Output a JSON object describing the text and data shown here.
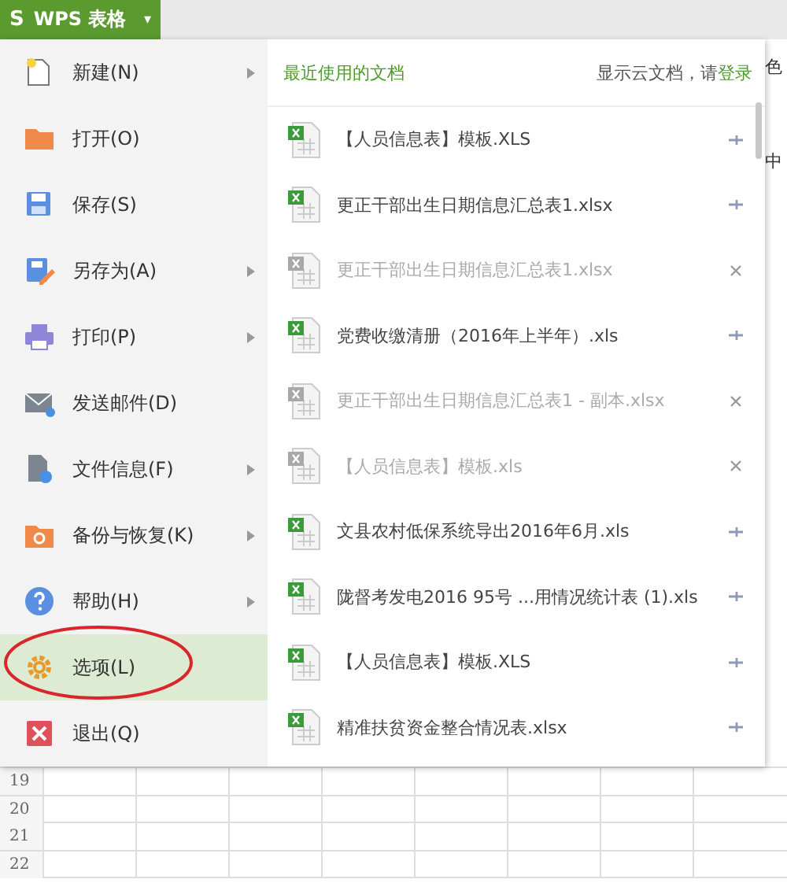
{
  "app_button": {
    "logo": "S",
    "label": "WPS 表格",
    "caret": "▾"
  },
  "menu": {
    "items": [
      {
        "label": "新建(N)",
        "has_submenu": true,
        "selected": false
      },
      {
        "label": "打开(O)",
        "has_submenu": false,
        "selected": false
      },
      {
        "label": "保存(S)",
        "has_submenu": false,
        "selected": false
      },
      {
        "label": "另存为(A)",
        "has_submenu": true,
        "selected": false
      },
      {
        "label": "打印(P)",
        "has_submenu": true,
        "selected": false
      },
      {
        "label": "发送邮件(D)",
        "has_submenu": false,
        "selected": false
      },
      {
        "label": "文件信息(F)",
        "has_submenu": true,
        "selected": false
      },
      {
        "label": "备份与恢复(K)",
        "has_submenu": true,
        "selected": false
      },
      {
        "label": "帮助(H)",
        "has_submenu": true,
        "selected": false
      },
      {
        "label": "选项(L)",
        "has_submenu": false,
        "selected": true
      },
      {
        "label": "退出(Q)",
        "has_submenu": false,
        "selected": false
      }
    ]
  },
  "recent": {
    "title": "最近使用的文档",
    "cloud_hint": "显示云文档，请",
    "login_link": "登录",
    "files": [
      {
        "name": "【人员信息表】模板.XLS",
        "missing": false
      },
      {
        "name": "更正干部出生日期信息汇总表1.xlsx",
        "missing": false
      },
      {
        "name": "更正干部出生日期信息汇总表1.xlsx",
        "missing": true
      },
      {
        "name": "党费收缴清册（2016年上半年）.xls",
        "missing": false
      },
      {
        "name": "更正干部出生日期信息汇总表1 - 副本.xlsx",
        "missing": true
      },
      {
        "name": "【人员信息表】模板.xls",
        "missing": true
      },
      {
        "name": "文县农村低保系统导出2016年6月.xls",
        "missing": false
      },
      {
        "name": "陇督考发电2016 95号 ...用情况统计表 (1).xls",
        "missing": false
      },
      {
        "name": "【人员信息表】模板.XLS",
        "missing": false
      },
      {
        "name": "精准扶贫资金整合情况表.xlsx",
        "missing": false
      }
    ]
  },
  "background_fragments": [
    "色",
    "中"
  ],
  "sheet": {
    "row_numbers": [
      "19",
      "20",
      "21",
      "22"
    ]
  }
}
